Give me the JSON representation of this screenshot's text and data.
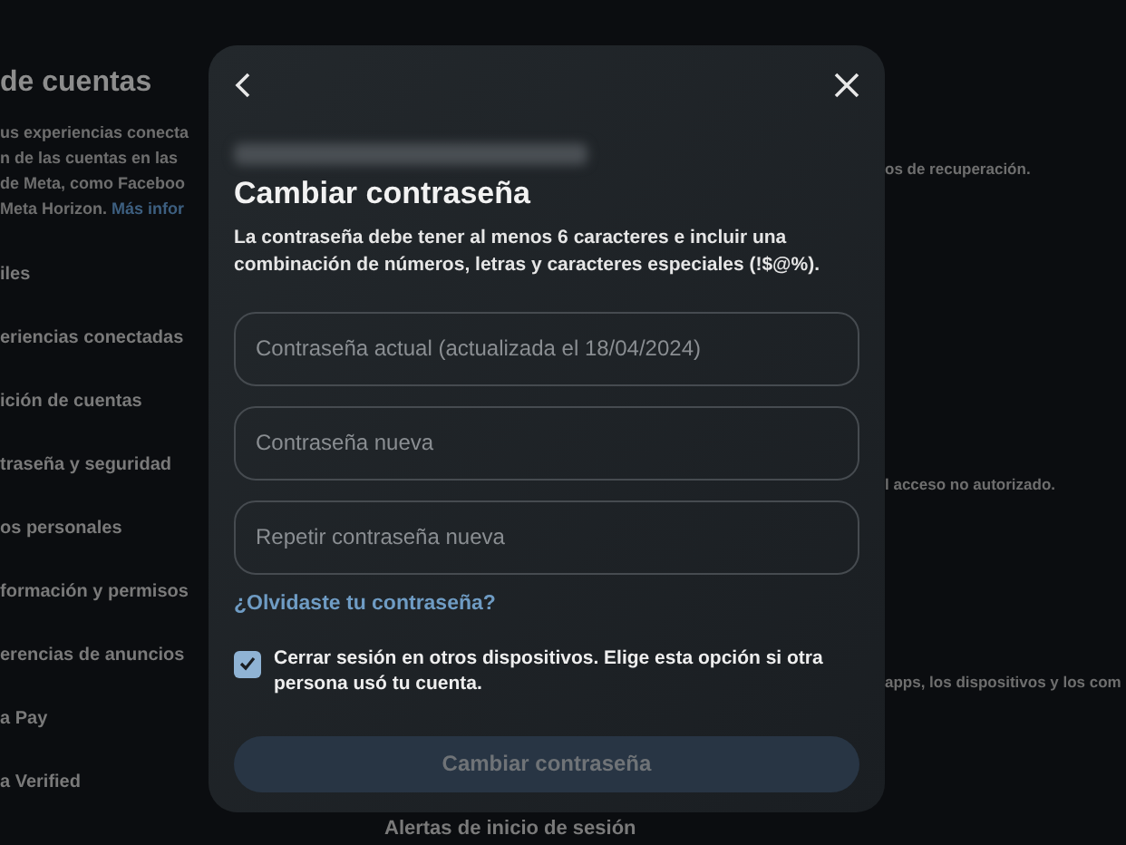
{
  "background_page": {
    "title": "de cuentas",
    "description": [
      "us experiencias conecta",
      "n de las cuentas en las",
      "de Meta, como Faceboo"
    ],
    "description_last": "Meta Horizon.",
    "description_link": "Más infor",
    "sidebar_items": [
      {
        "label": "iles"
      },
      {
        "label": "eriencias conectadas"
      },
      {
        "label": "ición de cuentas"
      },
      {
        "label": "traseña y seguridad"
      },
      {
        "label": "os personales"
      },
      {
        "label": "formación y permisos"
      },
      {
        "label": "erencias de anuncios"
      },
      {
        "label": "a Pay"
      },
      {
        "label": "a Verified"
      }
    ],
    "right_texts": [
      "os de recuperación.",
      "l acceso no autorizado.",
      "apps, los dispositivos y los com"
    ],
    "bottom_item": "Alertas de inicio de sesión"
  },
  "dialog": {
    "title": "Cambiar contraseña",
    "description": "La contraseña debe tener al menos 6 caracteres e incluir una combinación de números, letras y caracteres especiales (!$@%).",
    "fields": [
      {
        "placeholder": "Contraseña actual (actualizada el 18/04/2024)"
      },
      {
        "placeholder": "Contraseña nueva"
      },
      {
        "placeholder": "Repetir contraseña nueva"
      }
    ],
    "forgot_link": "¿Olvidaste tu contraseña?",
    "logout_option": {
      "label": "Cerrar sesión en otros dispositivos. Elige esta opción si otra persona usó tu cuenta.",
      "checked": true
    },
    "submit": {
      "label": "Cambiar contraseña",
      "disabled": true
    }
  }
}
